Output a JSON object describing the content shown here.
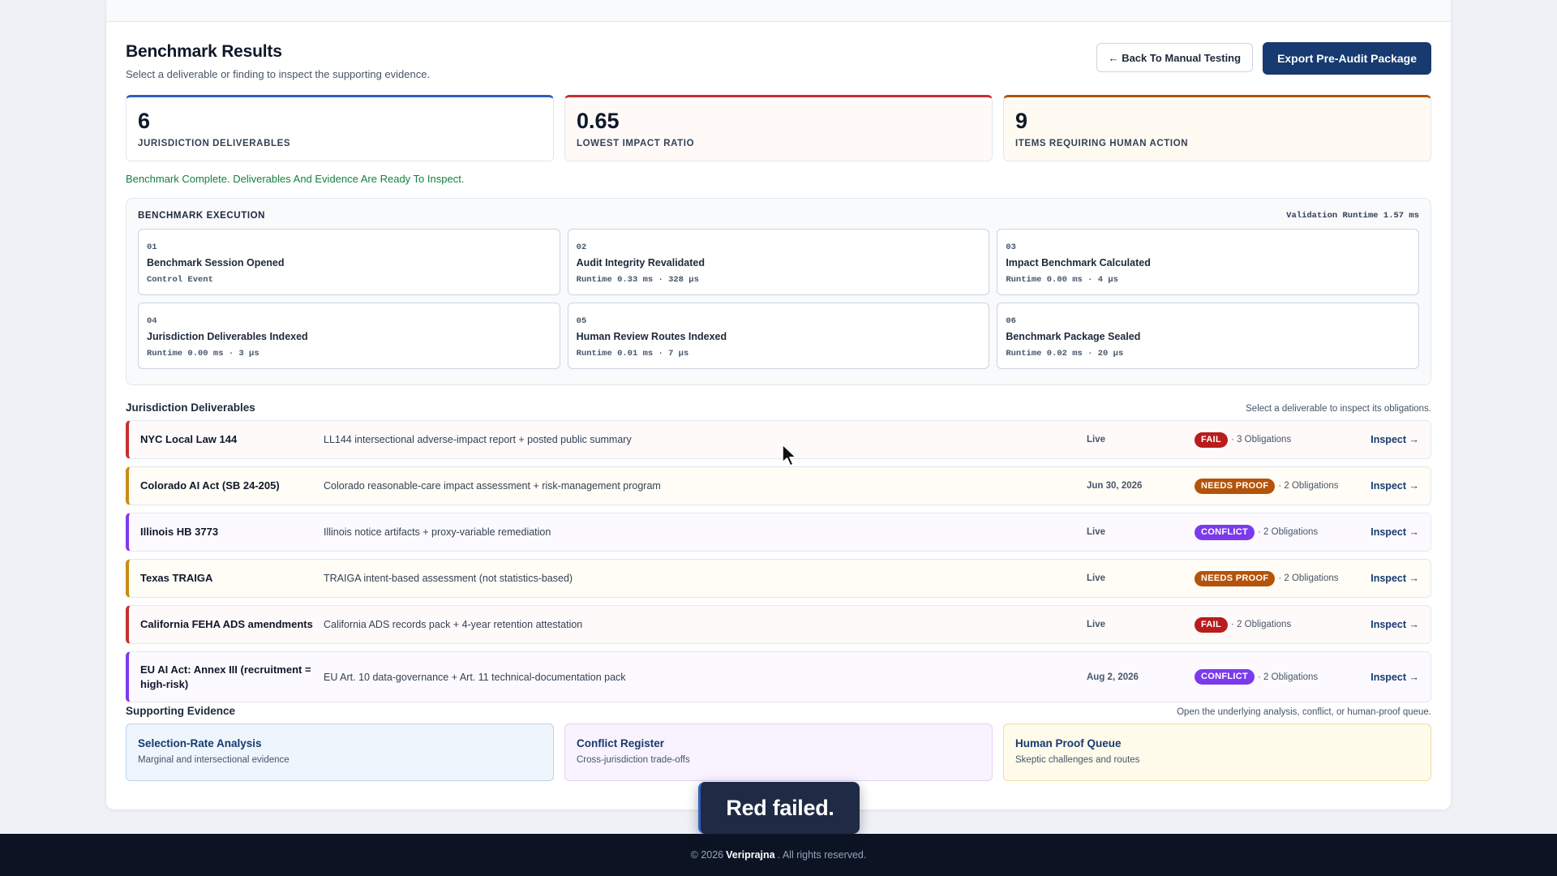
{
  "header": {
    "title": "Benchmark Results",
    "subtitle": "Select a deliverable or finding to inspect the supporting evidence.",
    "back_label": "← Back To Manual Testing",
    "export_label": "Export Pre-Audit Package"
  },
  "stats": [
    {
      "value": "6",
      "label": "JURISDICTION DELIVERABLES",
      "color": "#2f5fbf"
    },
    {
      "value": "0.65",
      "label": "LOWEST IMPACT RATIO",
      "color": "#c53030"
    },
    {
      "value": "9",
      "label": "ITEMS REQUIRING HUMAN ACTION",
      "color": "#b45309"
    }
  ],
  "status_message": "Benchmark Complete. Deliverables And Evidence Are Ready To Inspect.",
  "execution": {
    "title": "BENCHMARK EXECUTION",
    "runtime": "Validation Runtime 1.57 ms",
    "steps": [
      {
        "num": "01",
        "title": "Benchmark Session Opened",
        "meta": "Control Event"
      },
      {
        "num": "02",
        "title": "Audit Integrity Revalidated",
        "meta": "Runtime 0.33 ms · 328 µs"
      },
      {
        "num": "03",
        "title": "Impact Benchmark Calculated",
        "meta": "Runtime 0.00 ms · 4 µs"
      },
      {
        "num": "04",
        "title": "Jurisdiction Deliverables Indexed",
        "meta": "Runtime 0.00 ms · 3 µs"
      },
      {
        "num": "05",
        "title": "Human Review Routes Indexed",
        "meta": "Runtime 0.01 ms · 7 µs"
      },
      {
        "num": "06",
        "title": "Benchmark Package Sealed",
        "meta": "Runtime 0.02 ms · 20 µs"
      }
    ]
  },
  "deliverables": {
    "title": "Jurisdiction Deliverables",
    "hint": "Select a deliverable to inspect its obligations.",
    "inspect_label": "Inspect →",
    "items": [
      {
        "name": "NYC Local Law 144",
        "desc": "LL144 intersectional adverse-impact report + posted public summary",
        "date": "Live",
        "badge": "FAIL",
        "obligations": "· 3 Obligations"
      },
      {
        "name": "Colorado AI Act (SB 24-205)",
        "desc": "Colorado reasonable-care impact assessment + risk-management program",
        "date": "Jun 30, 2026",
        "badge": "NEEDS PROOF",
        "obligations": "· 2 Obligations"
      },
      {
        "name": "Illinois HB 3773",
        "desc": "Illinois notice artifacts + proxy-variable remediation",
        "date": "Live",
        "badge": "CONFLICT",
        "obligations": "· 2 Obligations"
      },
      {
        "name": "Texas TRAIGA",
        "desc": "TRAIGA intent-based assessment (not statistics-based)",
        "date": "Live",
        "badge": "NEEDS PROOF",
        "obligations": "· 2 Obligations"
      },
      {
        "name": "California FEHA ADS amendments",
        "desc": "California ADS records pack + 4-year retention attestation",
        "date": "Live",
        "badge": "FAIL",
        "obligations": "· 2 Obligations"
      },
      {
        "name": "EU AI Act: Annex III (recruitment = high-risk)",
        "desc": "EU Art. 10 data-governance + Art. 11 technical-documentation pack",
        "date": "Aug 2, 2026",
        "badge": "CONFLICT",
        "obligations": "· 2 Obligations"
      }
    ]
  },
  "evidence": {
    "title": "Supporting Evidence",
    "hint": "Open the underlying analysis, conflict, or human-proof queue.",
    "cards": [
      {
        "title": "Selection-Rate Analysis",
        "sub": "Marginal and intersectional evidence"
      },
      {
        "title": "Conflict Register",
        "sub": "Cross-jurisdiction trade-offs"
      },
      {
        "title": "Human Proof Queue",
        "sub": "Skeptic challenges and routes"
      }
    ]
  },
  "toast": "Red failed.",
  "footer": {
    "prefix": "© 2026",
    "brand": "Veriprajna",
    "suffix": ". All rights reserved."
  },
  "colors": {
    "fail": "#b91c1c",
    "needs_proof": "#b45309",
    "conflict": "#7c3aed",
    "primary": "#173a70"
  }
}
